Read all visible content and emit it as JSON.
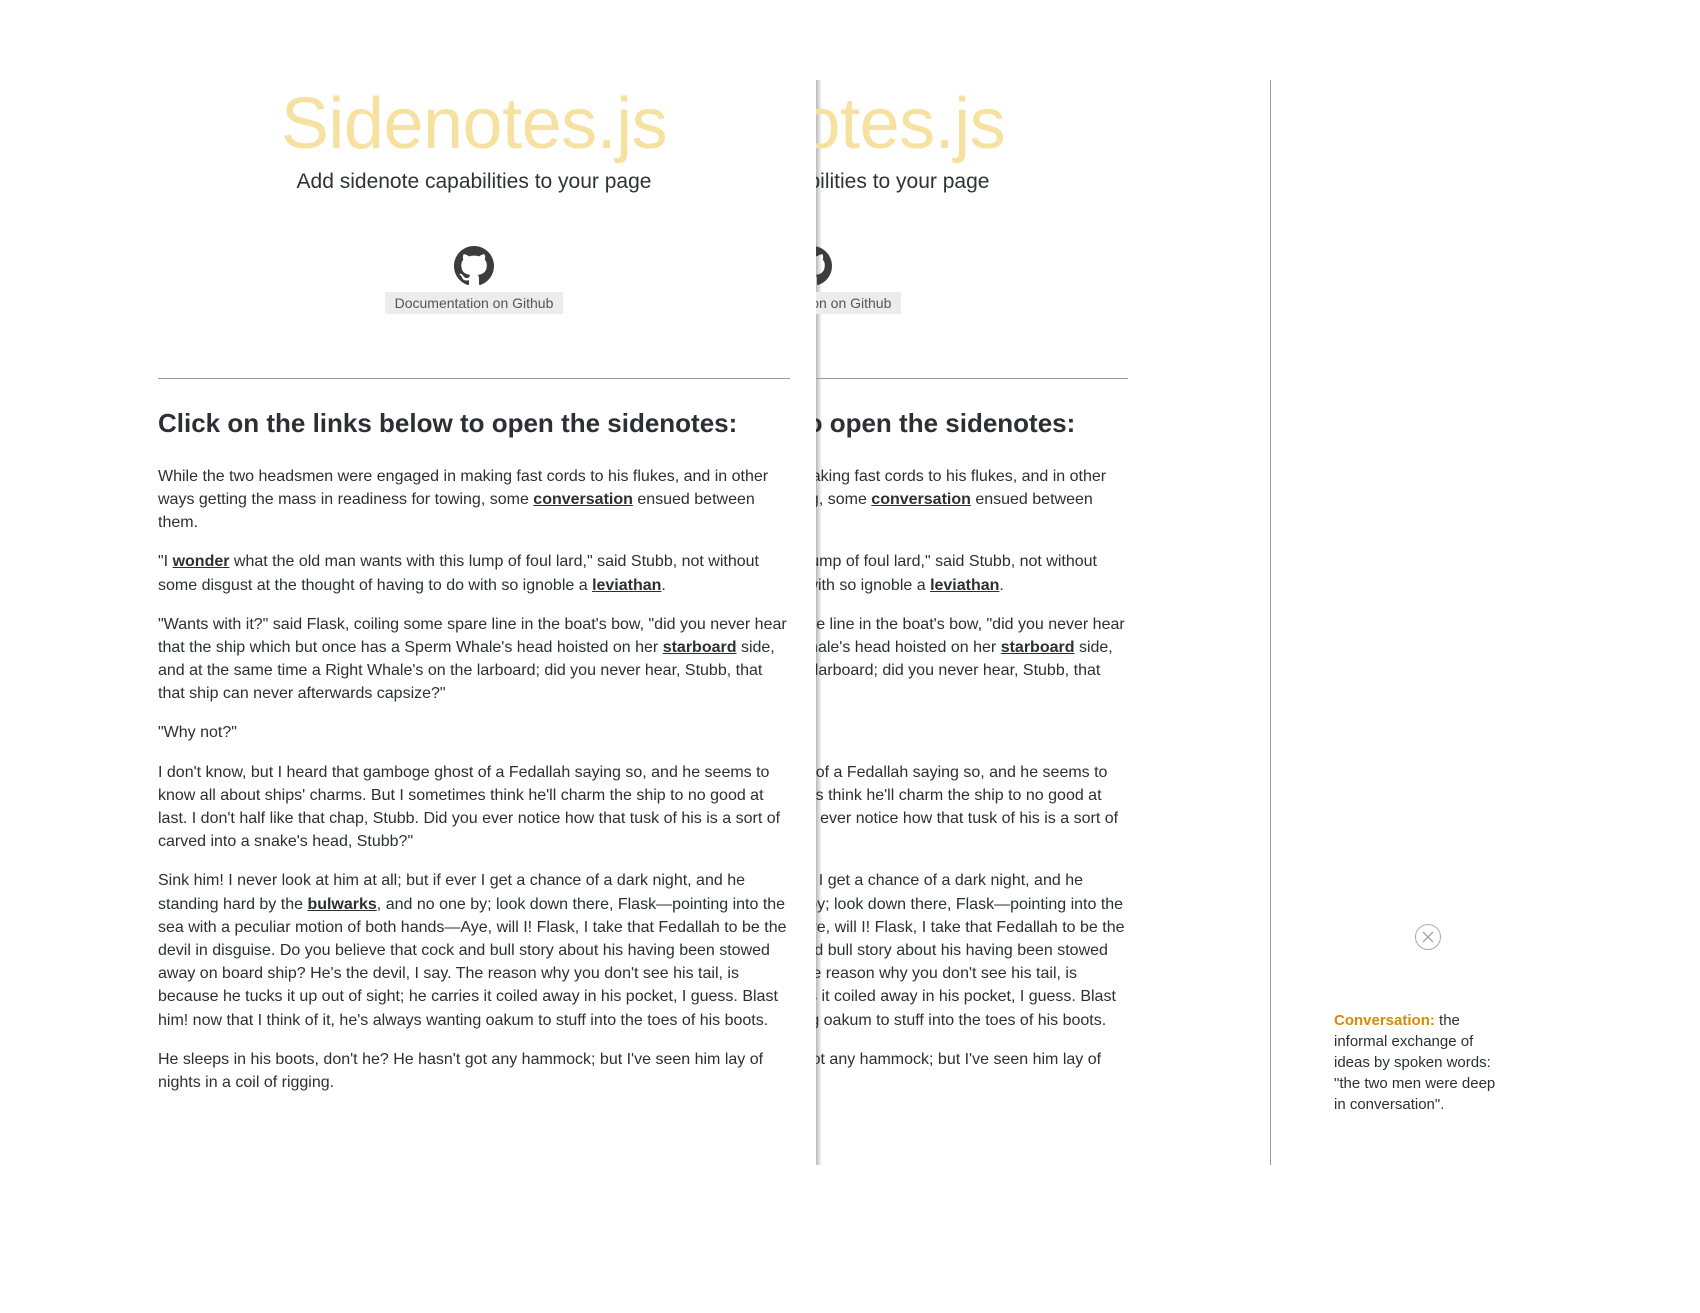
{
  "hero": {
    "title": "Sidenotes.js",
    "subtitle": "Add sidenote capabilities to your page",
    "github_label": "Documentation on Github"
  },
  "heading": "Click on the links below to open the sidenotes:",
  "p1_a": "While the two headsmen were engaged in making fast cords to his flukes, and in other ways getting the mass in readiness for towing, some ",
  "p1_link": "conversation",
  "p1_b": " ensued between them.",
  "p2_a": "\"I ",
  "p2_link": "wonder",
  "p2_b": " what the old man wants with this lump of foul lard,\" said Stubb, not without some disgust at the thought of having to do with so ignoble a ",
  "p2_link2": "leviathan",
  "p2_c": ".",
  "p3_a": "\"Wants with it?\" said Flask, coiling some spare line in the boat's bow, \"did you never hear that the ship which but once has a Sperm Whale's head hoisted on her ",
  "p3_link": "starboard",
  "p3_b": " side, and at the same time a Right Whale's on the larboard; did you never hear, Stubb, that that ship can never afterwards capsize?\"",
  "p4": "\"Why not?\"",
  "p5": "I don't know, but I heard that gamboge ghost of a Fedallah saying so, and he seems to know all about ships' charms. But I sometimes think he'll charm the ship to no good at last. I don't half like that chap, Stubb. Did you ever notice how that tusk of his is a sort of carved into a snake's head, Stubb?\"",
  "p6_a": "Sink him! I never look at him at all; but if ever I get a chance of a dark night, and he standing hard by the ",
  "p6_link": "bulwarks",
  "p6_b": ", and no one by; look down there, Flask—pointing into the sea with a peculiar motion of both hands—Aye, will I! Flask, I take that Fedallah to be the devil in disguise. Do you believe that cock and bull story about his having been stowed away on board ship? He's the devil, I say. The reason why you don't see his tail, is because he tucks it up out of sight; he carries it coiled away in his pocket, I guess. Blast him! now that I think of it, he's always wanting oakum to stuff into the toes of his boots.",
  "p7": "He sleeps in his boots, don't he? He hasn't got any hammock; but I've seen him lay of nights in a coil of rigging.",
  "sidenote": {
    "term": "Conversation:",
    "definition": " the informal exchange of ideas by spoken words: \"the two men were deep in conversation\"."
  }
}
